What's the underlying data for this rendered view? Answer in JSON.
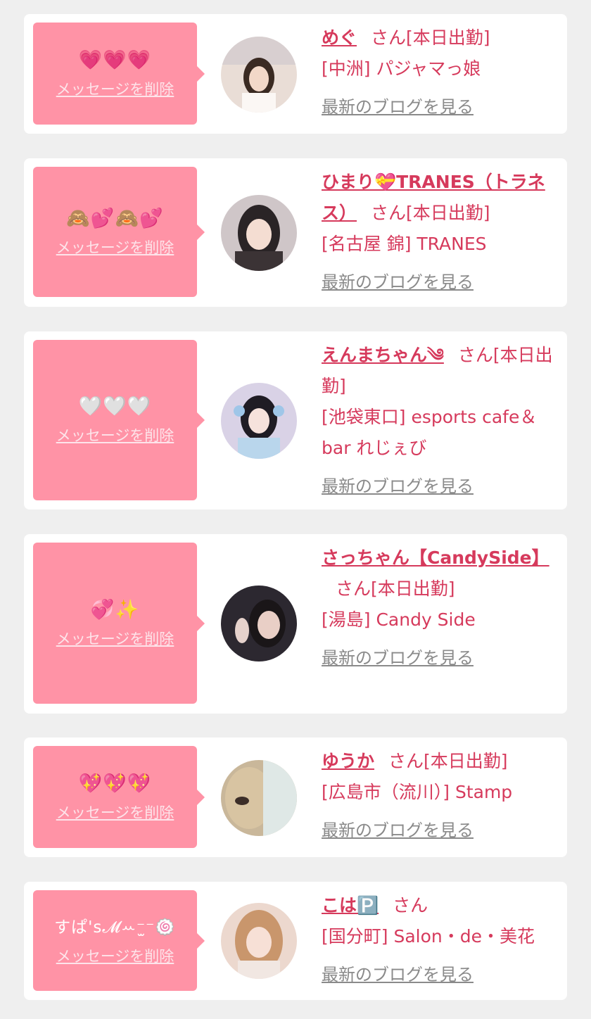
{
  "delete_label": "メッセージを削除",
  "blog_label": "最新のブログを見る",
  "colors": {
    "accent": "#d63a5c",
    "bubble": "#ff93a6",
    "background": "#efefef"
  },
  "cards": [
    {
      "emojis": "💗💗💗",
      "name": "めぐ",
      "status": "さん[本日出勤]",
      "shop": "[中洲] パジャマっ娘"
    },
    {
      "emojis": "🙈💕🙈💕",
      "name": "ひまり💝TRANES（トラネス）",
      "status": "さん[本日出勤]",
      "shop": "[名古屋 錦] TRANES"
    },
    {
      "emojis": "🤍🤍🤍",
      "name": "えんまちゃん༄",
      "status": "さん[本日出勤]",
      "shop": "[池袋東口] esports cafe＆bar れじぇび"
    },
    {
      "emojis": "💞✨",
      "name": "さっちゃん【CandySide】",
      "status": "さん[本日出勤]",
      "shop": "[湯島] Candy Side"
    },
    {
      "emojis": "💖💖💖",
      "name": "ゆうか",
      "status": "さん[本日出勤]",
      "shop": "[広島市（流川）] Stamp"
    },
    {
      "emojis": "すぱ's𝓜ꕀ⁻̫⁻🍥",
      "name": "こは🅿️",
      "status": "さん",
      "shop": "[国分町] Salon・de・美花"
    }
  ]
}
